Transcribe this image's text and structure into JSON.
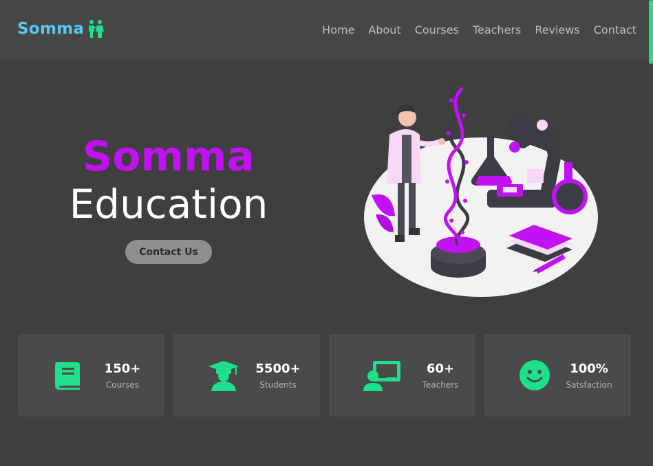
{
  "brand": {
    "name": "Somma"
  },
  "nav": [
    "Home",
    "About",
    "Courses",
    "Teachers",
    "Reviews",
    "Contact"
  ],
  "hero": {
    "title_line1": "Somma",
    "title_line2": "Education",
    "cta": "Contact Us"
  },
  "stats": [
    {
      "value": "150+",
      "label": "Courses",
      "icon": "book-icon"
    },
    {
      "value": "5500+",
      "label": "Students",
      "icon": "graduate-icon"
    },
    {
      "value": "60+",
      "label": "Teachers",
      "icon": "teacher-board-icon"
    },
    {
      "value": "100%",
      "label": "Satsfaction",
      "icon": "smiley-icon"
    }
  ],
  "colors": {
    "accent": "#1fe08a",
    "brand_purple": "#c012f2",
    "background": "#3f3f3f",
    "navbar": "#474747"
  }
}
